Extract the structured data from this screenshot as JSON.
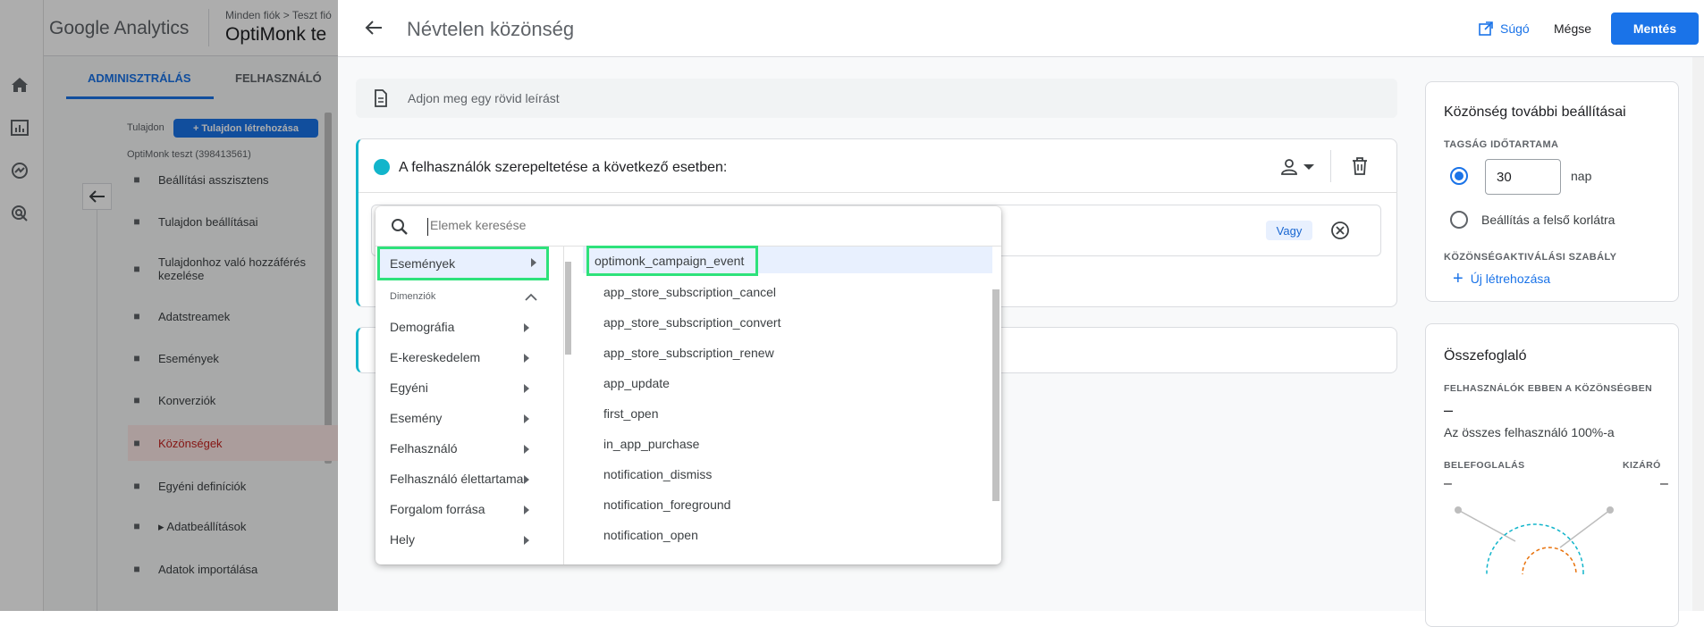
{
  "ga": {
    "app_name": "Google Analytics",
    "breadcrumb": "Minden fiók > Teszt fió",
    "property_short": "OptiMonk te",
    "tab_admin": "ADMINISZTRÁLÁS",
    "tab_user": "FELHASZNÁLÓ",
    "property_label": "Tulajdon",
    "create_property": "+ Tulajdon létrehozása",
    "property_name": "OptiMonk teszt (398413561)",
    "nav": [
      {
        "label": "Beállítási asszisztens",
        "icon": "checklist-icon"
      },
      {
        "label": "Tulajdon beállításai",
        "icon": "settings-page-icon"
      },
      {
        "label": "Tulajdonhoz való hozzáférés kezelése",
        "icon": "people-icon"
      },
      {
        "label": "Adatstreamek",
        "icon": "streams-icon"
      },
      {
        "label": "Események",
        "icon": "touch-icon"
      },
      {
        "label": "Konverziók",
        "icon": "flag-icon"
      },
      {
        "label": "Közönségek",
        "icon": "audience-icon"
      },
      {
        "label": "Egyéni definíciók",
        "icon": "shapes-icon"
      },
      {
        "label": "▸ Adatbeállítások",
        "icon": "database-icon"
      },
      {
        "label": "Adatok importálása",
        "icon": "upload-icon"
      }
    ]
  },
  "panel": {
    "title": "Névtelen közönség",
    "help": "Súgó",
    "cancel": "Mégse",
    "save": "Mentés",
    "description_placeholder": "Adjon meg egy rövid leírást",
    "condition_title": "A felhasználók szerepeltetése a következő esetben:",
    "or_chip": "Vagy"
  },
  "dropdown": {
    "search_placeholder": "Elemek keresése",
    "selected_category": "Események",
    "dimensions_header": "Dimenziók",
    "categories": [
      "Demográfia",
      "E-kereskedelem",
      "Egyéni",
      "Esemény",
      "Felhasználó",
      "Felhasználó élettartama",
      "Forgalom forrása",
      "Hely"
    ],
    "events": [
      "optimonk_campaign_event",
      "app_store_subscription_cancel",
      "app_store_subscription_convert",
      "app_store_subscription_renew",
      "app_update",
      "first_open",
      "in_app_purchase",
      "notification_dismiss",
      "notification_foreground",
      "notification_open"
    ]
  },
  "settings": {
    "title": "Közönség további beállításai",
    "membership_label": "TAGSÁG IDŐTARTAMA",
    "duration_value": "30",
    "duration_unit": "nap",
    "max_option": "Beállítás a felső korlátra",
    "trigger_label": "KÖZÖNSÉGAKTIVÁLÁSI SZABÁLY",
    "new_trigger": "Új létrehozása"
  },
  "summary": {
    "title": "Összefoglaló",
    "users_label": "FELHASZNÁLÓK EBBEN A KÖZÖNSÉGBEN",
    "users_value": "–",
    "users_pct": "Az összes felhasználó 100%-a",
    "include_label": "BELEFOGLALÁS",
    "exclude_label": "KIZÁRÓ",
    "include_value": "–",
    "exclude_value": "–"
  },
  "colors": {
    "accent": "#1a73e8",
    "highlight": "#2ee27b",
    "active_red": "#c5221f"
  }
}
